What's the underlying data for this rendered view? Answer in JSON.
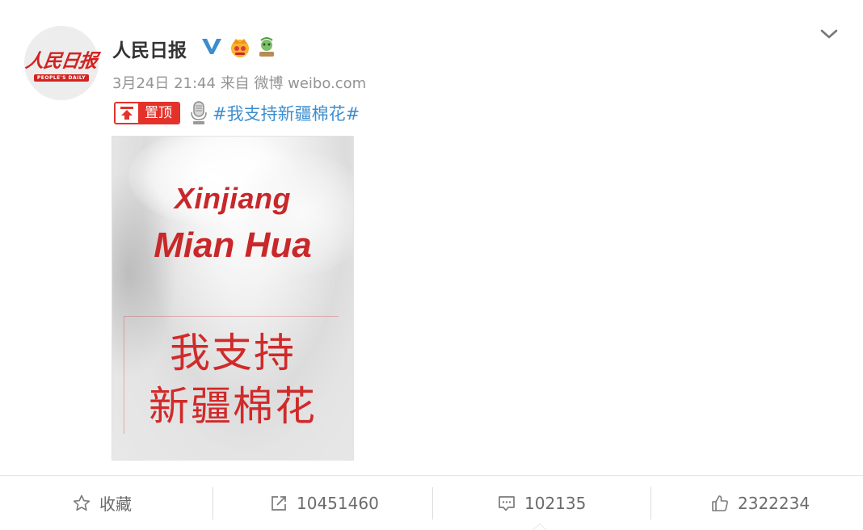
{
  "post": {
    "author": {
      "name": "人民日报",
      "avatar_logo_cn": "人民日报",
      "avatar_logo_en": "PEOPLE'S DAILY",
      "verified_icon": "verified-v-icon",
      "badges": [
        "crown-badge-icon",
        "plant-badge-icon"
      ]
    },
    "meta": {
      "time": "3月24日 21:44",
      "source": "来自 微博 weibo.com"
    },
    "pin": {
      "label": "置顶",
      "icon": "pin-up-icon"
    },
    "topic_icon": "microphone-icon",
    "hashtag": "#我支持新疆棉花#",
    "image": {
      "line1": "Xinjiang",
      "line2": "Mian Hua",
      "cn_line1": "我支持",
      "cn_line2": "新疆棉花"
    }
  },
  "actions": {
    "favorite": {
      "label": "收藏",
      "icon": "star-icon"
    },
    "repost": {
      "count": "10451460",
      "icon": "share-icon"
    },
    "comment": {
      "count": "102135",
      "icon": "comment-icon"
    },
    "like": {
      "count": "2322234",
      "icon": "thumbs-up-icon"
    }
  },
  "colors": {
    "accent_blue": "#3c8dcf",
    "pin_red": "#e4322b",
    "image_red": "#c8282a",
    "meta_gray": "#939393"
  }
}
